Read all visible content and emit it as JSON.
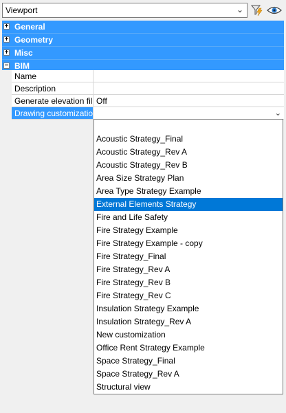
{
  "toolbar": {
    "selector_value": "Viewport",
    "filter_icon": "filter-lightning-icon",
    "eye_icon": "eye-icon"
  },
  "categories": [
    {
      "label": "General",
      "state": "+"
    },
    {
      "label": "Geometry",
      "state": "+"
    },
    {
      "label": "Misc",
      "state": "+"
    },
    {
      "label": "BIM",
      "state": "−"
    }
  ],
  "properties": [
    {
      "name": "Name",
      "value": ""
    },
    {
      "name": "Description",
      "value": ""
    },
    {
      "name": "Generate elevation fill",
      "value": "Off"
    },
    {
      "name": "Drawing customization",
      "value": ""
    }
  ],
  "dropdown": {
    "items": [
      "",
      "Acoustic Strategy_Final",
      "Acoustic Strategy_Rev A",
      "Acoustic Strategy_Rev B",
      "Area Size Strategy Plan",
      "Area Type Strategy Example",
      "External Elements Strategy",
      "Fire and Life Safety",
      "Fire Strategy Example",
      "Fire Strategy Example - copy",
      "Fire Strategy_Final",
      "Fire Strategy_Rev A",
      "Fire Strategy_Rev B",
      "Fire Strategy_Rev C",
      "Insulation Strategy Example",
      "Insulation Strategy_Rev A",
      "New customization",
      "Office Rent Strategy Example",
      "Space Strategy_Final",
      "Space Strategy_Rev A",
      "Structural view"
    ],
    "highlighted": "External Elements Strategy"
  },
  "colors": {
    "category_bg": "#3399ff",
    "highlight_bg": "#0078d7"
  }
}
